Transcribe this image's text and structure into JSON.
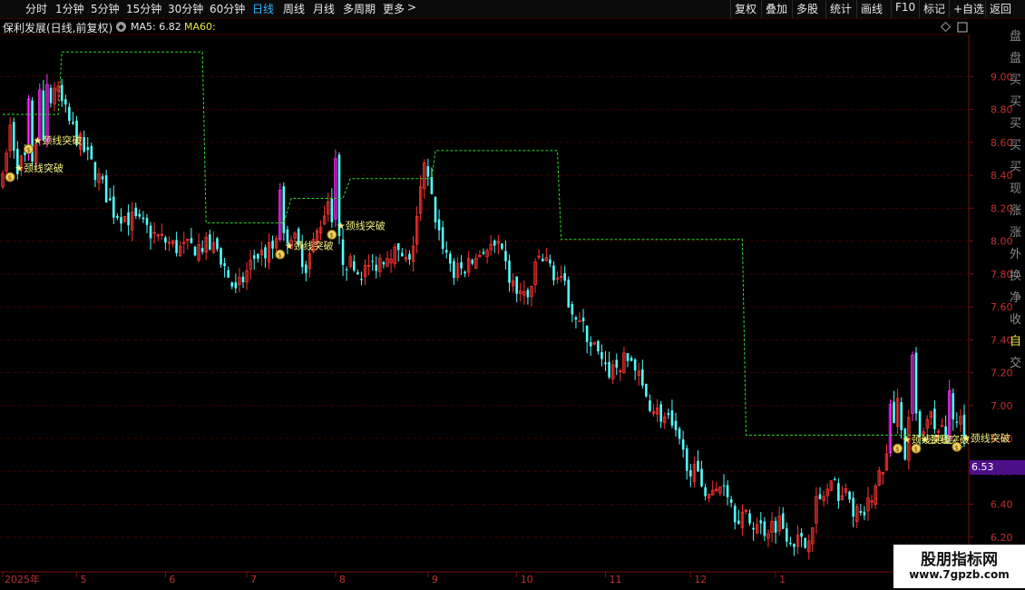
{
  "toolbar": {
    "periods": [
      "分时",
      "1分钟",
      "5分钟",
      "15分钟",
      "30分钟",
      "60分钟",
      "日线",
      "周线",
      "月线",
      "多周期",
      "更多"
    ],
    "active_period": "日线",
    "tools": [
      "复权",
      "叠加",
      "多股",
      "统计",
      "画线",
      "F10",
      "标记",
      "+自选",
      "返回"
    ]
  },
  "info": {
    "title": "保利发展(日线,前复权)",
    "ma5": "MA5: 6.82",
    "ma60": "MA60:"
  },
  "price_tag": "6.53",
  "side_chars": [
    "盘",
    "盘",
    "买",
    "买",
    "买",
    "买",
    "买",
    "现",
    "涨",
    "涨",
    "外",
    "换",
    "净",
    "收",
    "自",
    "交"
  ],
  "watermark": {
    "title": "股朋指标网",
    "url": "www.7gpzb.com"
  },
  "annotation_text": "★颈线突破",
  "chart_data": {
    "type": "candlestick",
    "ylim": [
      6.0,
      9.3
    ],
    "yticks": [
      "9.00",
      "8.80",
      "8.60",
      "8.40",
      "8.20",
      "8.00",
      "7.80",
      "7.60",
      "7.40",
      "7.20",
      "7.00",
      "6.80",
      "6.60",
      "6.40",
      "6.20"
    ],
    "xticks": [
      "2025年",
      "5",
      "6",
      "7",
      "8",
      "9",
      "10",
      "11",
      "12",
      "1"
    ],
    "colors": {
      "up": "#ff3232",
      "down": "#54fcfc",
      "highlight": "#ff30ff",
      "ma60": "#3cc83c",
      "neck_line": "#2fd82f",
      "grid": "#3a0000",
      "axis_text": "#c03030"
    },
    "keypoints": [
      [
        0,
        8.36
      ],
      [
        2,
        8.7
      ],
      [
        4,
        8.46
      ],
      [
        6,
        8.5
      ],
      [
        10,
        8.55
      ],
      [
        14,
        8.95
      ],
      [
        18,
        8.72
      ],
      [
        22,
        8.55
      ],
      [
        26,
        8.38
      ],
      [
        30,
        8.18
      ],
      [
        36,
        8.12
      ],
      [
        42,
        8.02
      ],
      [
        48,
        7.95
      ],
      [
        54,
        7.97
      ],
      [
        58,
        7.95
      ],
      [
        63,
        7.68
      ],
      [
        68,
        7.9
      ],
      [
        73,
        7.95
      ],
      [
        78,
        8.05
      ],
      [
        82,
        7.85
      ],
      [
        88,
        8.25
      ],
      [
        92,
        7.9
      ],
      [
        96,
        7.8
      ],
      [
        100,
        7.85
      ],
      [
        105,
        7.95
      ],
      [
        110,
        7.85
      ],
      [
        114,
        8.45
      ],
      [
        118,
        8.05
      ],
      [
        122,
        7.8
      ],
      [
        126,
        7.85
      ],
      [
        130,
        7.95
      ],
      [
        134,
        7.95
      ],
      [
        138,
        7.72
      ],
      [
        142,
        7.65
      ],
      [
        145,
        7.9
      ],
      [
        148,
        7.85
      ],
      [
        152,
        7.7
      ],
      [
        156,
        7.5
      ],
      [
        160,
        7.35
      ],
      [
        163,
        7.2
      ],
      [
        167,
        7.25
      ],
      [
        170,
        7.28
      ],
      [
        173,
        7.1
      ],
      [
        176,
        6.98
      ],
      [
        180,
        6.9
      ],
      [
        184,
        6.7
      ],
      [
        188,
        6.55
      ],
      [
        192,
        6.45
      ],
      [
        195,
        6.55
      ],
      [
        198,
        6.35
      ],
      [
        202,
        6.3
      ],
      [
        206,
        6.25
      ],
      [
        210,
        6.3
      ],
      [
        213,
        6.2
      ],
      [
        217,
        6.15
      ],
      [
        220,
        6.4
      ],
      [
        224,
        6.5
      ],
      [
        228,
        6.45
      ],
      [
        232,
        6.3
      ],
      [
        236,
        6.5
      ],
      [
        240,
        6.75
      ],
      [
        242,
        7.0
      ],
      [
        244,
        6.7
      ],
      [
        246,
        7.05
      ],
      [
        248,
        6.8
      ],
      [
        250,
        6.95
      ],
      [
        253,
        6.9
      ],
      [
        256,
        6.8
      ],
      [
        258,
        6.95
      ],
      [
        260,
        6.82
      ]
    ],
    "highlight_bars": [
      7,
      10,
      12,
      75,
      90,
      240,
      246,
      256
    ],
    "neck_line_steps": [
      [
        0,
        8.77
      ],
      [
        15,
        8.77
      ],
      [
        16,
        9.15
      ],
      [
        54,
        9.15
      ],
      [
        55,
        8.11
      ],
      [
        76,
        8.11
      ],
      [
        78,
        8.26
      ],
      [
        92,
        8.26
      ],
      [
        94,
        8.38
      ],
      [
        116,
        8.38
      ],
      [
        117,
        8.55
      ],
      [
        150,
        8.55
      ],
      [
        151,
        8.01
      ],
      [
        200,
        8.01
      ],
      [
        201,
        6.82
      ],
      [
        255,
        6.82
      ],
      [
        257,
        6.75
      ],
      [
        260,
        6.75
      ]
    ],
    "annotations": [
      {
        "index": 2,
        "price": 8.4
      },
      {
        "index": 7,
        "price": 8.57
      },
      {
        "index": 75,
        "price": 7.93
      },
      {
        "index": 89,
        "price": 8.05
      },
      {
        "index": 242,
        "price": 6.75
      },
      {
        "index": 247,
        "price": 6.75
      },
      {
        "index": 258,
        "price": 6.76
      }
    ]
  }
}
